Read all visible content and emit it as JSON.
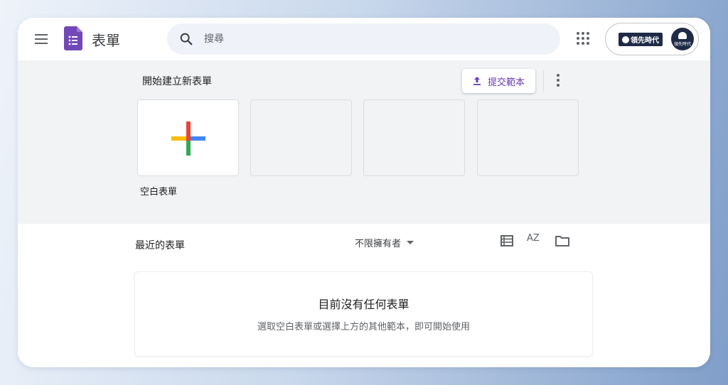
{
  "header": {
    "app_title": "表單",
    "search_placeholder": "搜尋"
  },
  "account": {
    "brand_text": "領先時代",
    "avatar_text": "領先時代"
  },
  "gallery": {
    "title": "開始建立新表單",
    "submit_template_label": "提交範本",
    "templates": [
      {
        "label": "空白表單"
      }
    ]
  },
  "recent": {
    "title": "最近的表單",
    "owner_filter": "不限擁有者",
    "sort_icon_text": "AZ",
    "empty_title": "目前沒有任何表單",
    "empty_subtitle": "選取空白表單或選擇上方的其他範本，即可開始使用"
  },
  "colors": {
    "accent": "#673ab7",
    "forms_brand": "#7248b9",
    "plus_red": "#ea4335",
    "plus_blue": "#4285f4",
    "plus_yellow": "#fbbc04",
    "plus_green": "#34a853"
  }
}
